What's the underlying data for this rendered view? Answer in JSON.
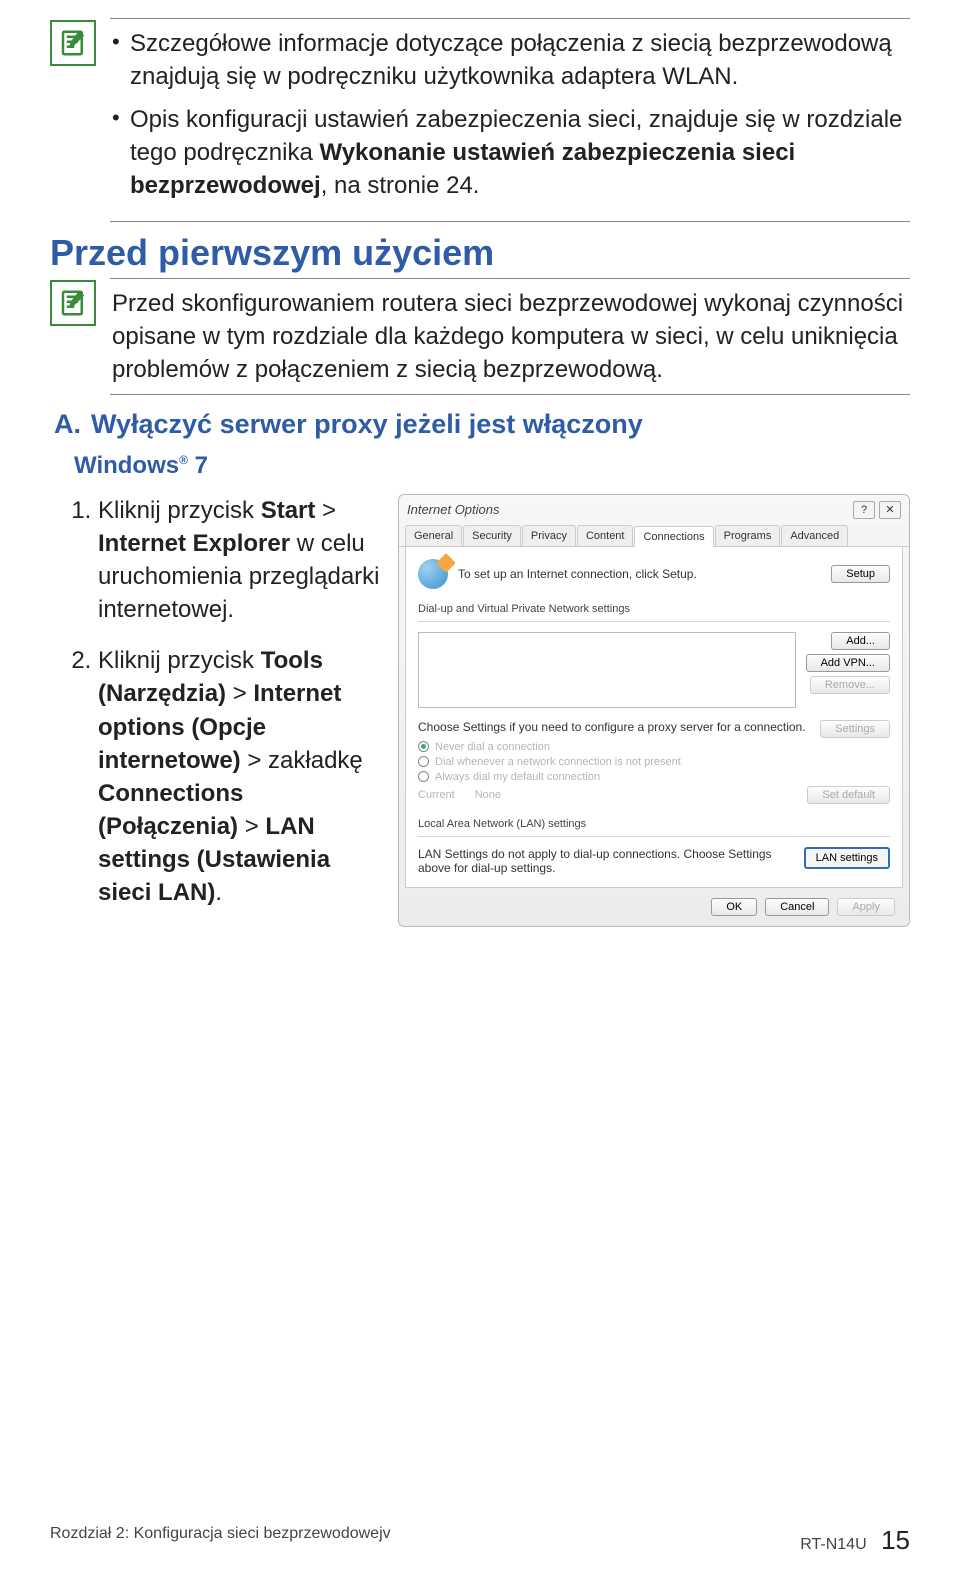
{
  "notes1": {
    "items": [
      "Szczegółowe informacje dotyczące połączenia z siecią bezprzewodową znajdują się w podręczniku użytkownika adaptera WLAN.",
      {
        "pre": "Opis konfiguracji ustawień zabezpieczenia sieci, znajduje się w rozdziale tego podręcznika ",
        "bold": "Wykonanie ustawień zabezpieczenia sieci bezprzewodowej",
        "post": ", na stronie 24."
      }
    ]
  },
  "section_before_title": "Przed pierwszym użyciem",
  "notes2": {
    "text": "Przed skonfigurowaniem routera sieci bezprzewodowej wykonaj czynności opisane w tym rozdziale dla każdego komputera w sieci, w celu uniknięcia problemów z połączeniem z siecią bezprzewodową."
  },
  "sectionA": {
    "label": "A.",
    "title": "Wyłączyć serwer proxy jeżeli jest włączony"
  },
  "windows_label": "Windows",
  "windows_ver": " 7",
  "steps": [
    {
      "pre": "Kliknij przycisk ",
      "b1": "Start",
      "mid1": " > ",
      "b2": "Internet Explorer",
      "post": " w celu uruchomienia przeglądarki internetowej."
    },
    {
      "pre": "Kliknij przycisk ",
      "b1": "Tools (Narzędzia)",
      "mid1": " > ",
      "b2": "Internet options (Opcje internetowe)",
      "mid2": " > zakładkę ",
      "b3": "Connections (Połączenia)",
      "mid3": " > ",
      "b4": "LAN settings (Ustawienia sieci LAN)",
      "post": "."
    }
  ],
  "dialog": {
    "title": "Internet Options",
    "help": "?",
    "close": "✕",
    "tabs": [
      "General",
      "Security",
      "Privacy",
      "Content",
      "Connections",
      "Programs",
      "Advanced"
    ],
    "active_tab": "Connections",
    "setup_text": "To set up an Internet connection, click Setup.",
    "setup_btn": "Setup",
    "dial_label": "Dial-up and Virtual Private Network settings",
    "add_btn": "Add...",
    "addvpn_btn": "Add VPN...",
    "remove_btn": "Remove...",
    "proxy_text": "Choose Settings if you need to configure a proxy server for a connection.",
    "settings_btn": "Settings",
    "r1": "Never dial a connection",
    "r2": "Dial whenever a network connection is not present",
    "r3": "Always dial my default connection",
    "current_label": "Current",
    "current_value": "None",
    "setdefault_btn": "Set default",
    "lan_label": "Local Area Network (LAN) settings",
    "lan_text": "LAN Settings do not apply to dial-up connections. Choose Settings above for dial-up settings.",
    "lan_btn": "LAN settings",
    "ok": "OK",
    "cancel": "Cancel",
    "apply": "Apply"
  },
  "footer": {
    "left": "Rozdział 2: Konfiguracja sieci bezprzewodowejv",
    "right_label": "RT-N14U",
    "page": "15"
  }
}
